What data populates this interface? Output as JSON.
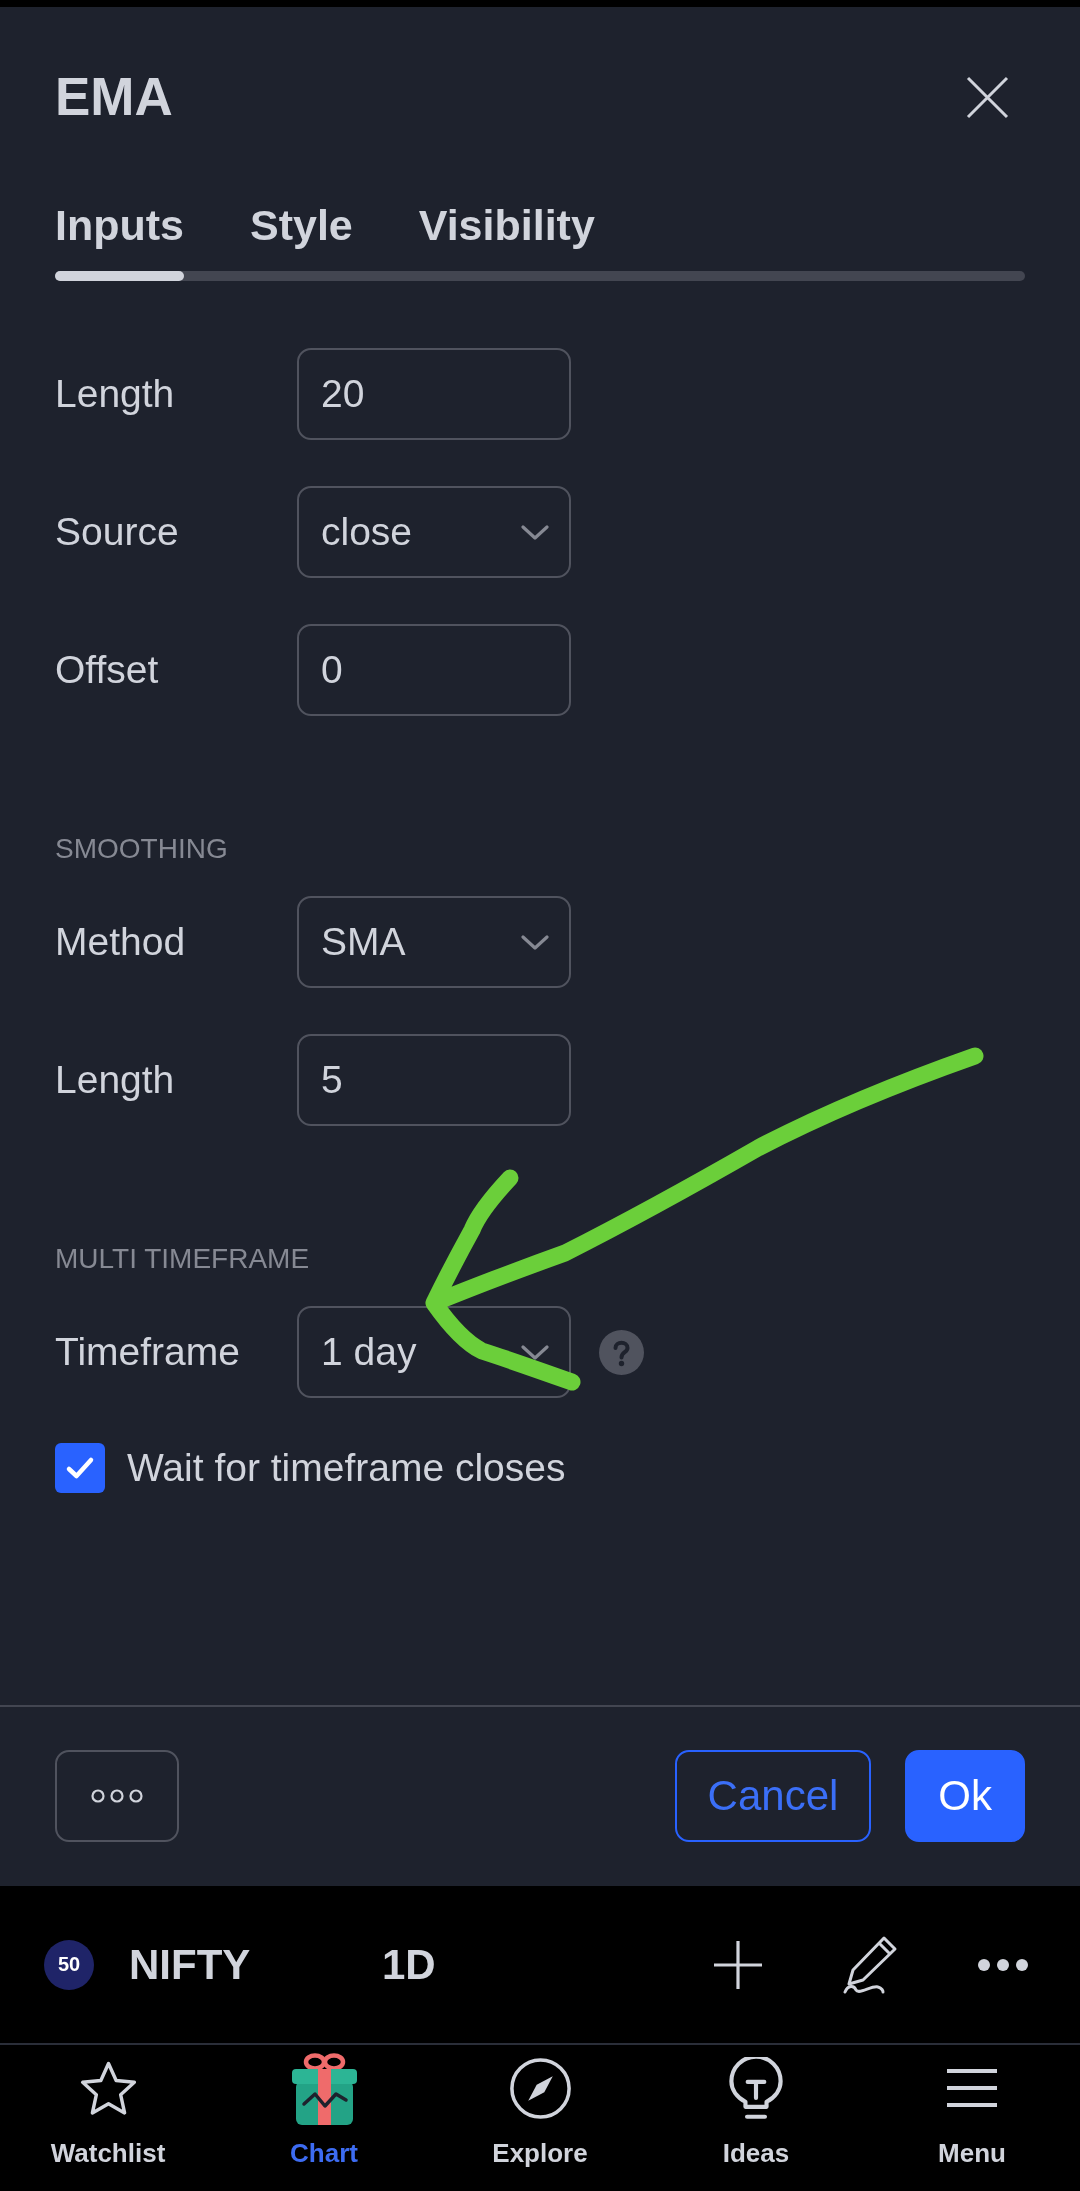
{
  "dialog": {
    "title": "EMA",
    "tabs": [
      {
        "label": "Inputs",
        "selected": true
      },
      {
        "label": "Style",
        "selected": false
      },
      {
        "label": "Visibility",
        "selected": false
      }
    ],
    "sections": [
      {
        "fields": [
          {
            "kind": "number",
            "label": "Length",
            "value": "20",
            "help": false
          },
          {
            "kind": "select",
            "label": "Source",
            "value": "close",
            "help": false
          },
          {
            "kind": "number",
            "label": "Offset",
            "value": "0",
            "help": false
          }
        ]
      },
      {
        "heading": "SMOOTHING",
        "fields": [
          {
            "kind": "select",
            "label": "Method",
            "value": "SMA",
            "help": false
          },
          {
            "kind": "number",
            "label": "Length",
            "value": "5",
            "help": false
          }
        ]
      },
      {
        "heading": "MULTI TIMEFRAME",
        "fields": [
          {
            "kind": "select",
            "label": "Timeframe",
            "value": "1 day",
            "help": true
          },
          {
            "kind": "checkbox",
            "label": "Wait for timeframe closes",
            "checked": true
          }
        ]
      }
    ],
    "footer_buttons": [
      {
        "kind": "more"
      },
      {
        "kind": "outline",
        "label": "Cancel"
      },
      {
        "kind": "primary",
        "label": "Ok"
      }
    ]
  },
  "annotations": [
    {
      "kind": "arrow"
    }
  ],
  "watchlist_row": {
    "badge": "50",
    "symbol": "NIFTY",
    "interval": "1D"
  },
  "bottom_nav": [
    {
      "label": "Watchlist",
      "selected": false
    },
    {
      "label": "Chart",
      "selected": true
    },
    {
      "label": "Explore",
      "selected": false
    },
    {
      "label": "Ideas",
      "selected": false
    },
    {
      "label": "Menu",
      "selected": false
    }
  ]
}
